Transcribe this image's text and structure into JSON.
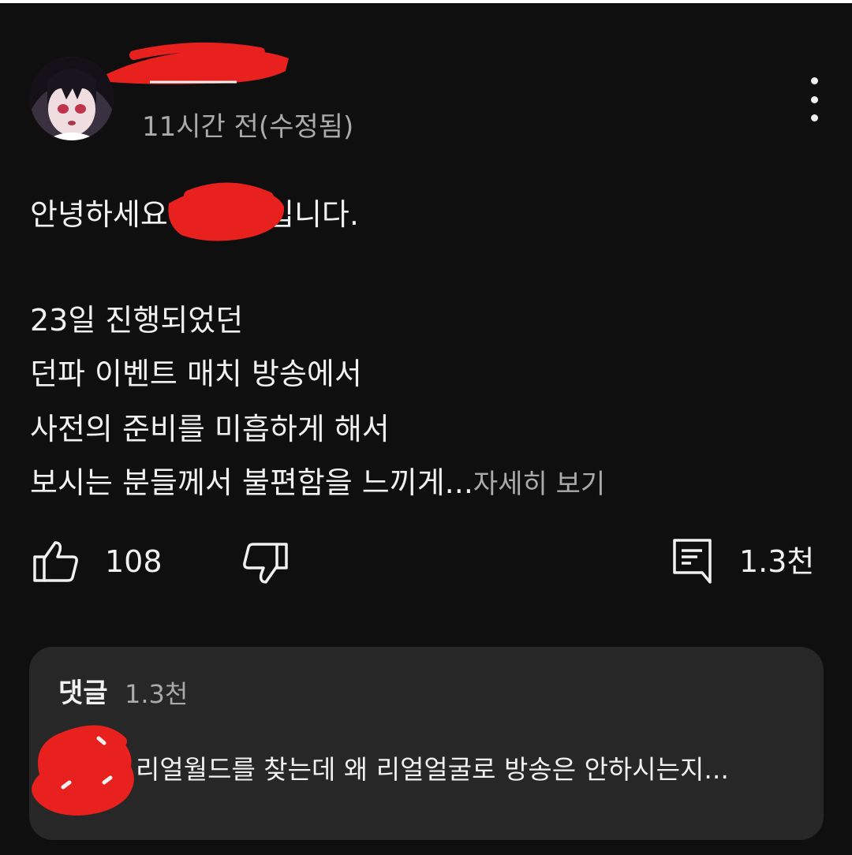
{
  "comment": {
    "timestamp": "11시간 전(수정됨)",
    "body_lines": [
      "안녕하세요",
      "입니다.",
      "23일 진행되었던",
      "던파 이벤트 매치 방송에서",
      "사전의 준비를 미흡하게 해서",
      "보시는 분들께서 불편함을 느끼게..."
    ],
    "read_more": "자세히 보기",
    "like_count": "108",
    "reply_count": "1.3천"
  },
  "comments_section": {
    "title": "댓글",
    "count": "1.3천",
    "preview": "리얼월드를 찾는데 왜 리얼얼굴로 방송은 안하시는지..."
  },
  "colors": {
    "background": "#0f0f0f",
    "panel": "#272727",
    "primary_text": "#f1f1f1",
    "secondary_text": "#aaaaaa",
    "redaction": "#e8211e"
  },
  "icons": {
    "more": "more-vertical-icon",
    "like": "thumbs-up-icon",
    "dislike": "thumbs-down-icon",
    "reply": "comment-icon"
  }
}
